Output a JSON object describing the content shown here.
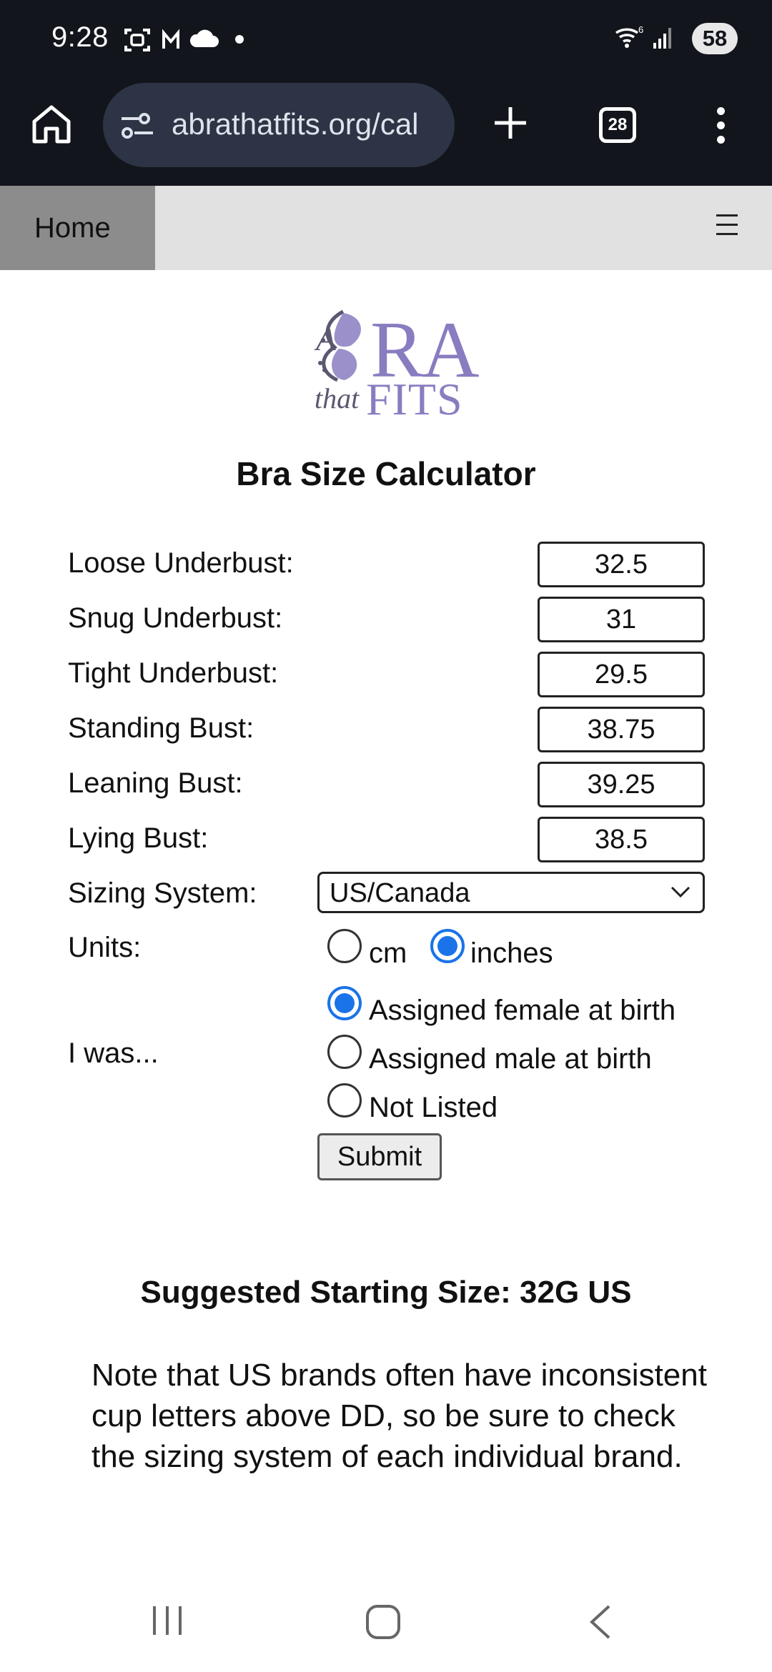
{
  "status_bar": {
    "time": "9:28",
    "battery": "58",
    "icons": [
      "screenshot-icon",
      "gmail-icon",
      "cloud-icon",
      "dot-icon",
      "wifi-icon",
      "signal-icon",
      "battery-icon"
    ]
  },
  "browser": {
    "url": "abrathatfits.org/cal",
    "tab_count": "28",
    "icons": [
      "home-icon",
      "site-settings-icon",
      "new-tab-icon",
      "tab-switcher-icon",
      "overflow-menu-icon"
    ]
  },
  "site_nav": {
    "home_label": "Home",
    "menu_icon": "hamburger-icon"
  },
  "logo": {
    "a": "A",
    "ra": "RA",
    "that": "that",
    "fits": "FITS"
  },
  "calculator": {
    "title": "Bra Size Calculator",
    "fields": [
      {
        "label": "Loose Underbust:",
        "value": "32.5"
      },
      {
        "label": "Snug Underbust:",
        "value": "31"
      },
      {
        "label": "Tight Underbust:",
        "value": "29.5"
      },
      {
        "label": "Standing Bust:",
        "value": "38.75"
      },
      {
        "label": "Leaning Bust:",
        "value": "39.25"
      },
      {
        "label": "Lying Bust:",
        "value": "38.5"
      }
    ],
    "sizing_system": {
      "label": "Sizing System:",
      "selected": "US/Canada"
    },
    "units": {
      "label": "Units:",
      "options": [
        "cm",
        "inches"
      ],
      "selected": "inches"
    },
    "assigned": {
      "label": "I was...",
      "options": [
        "Assigned female at birth",
        "Assigned male at birth",
        "Not Listed"
      ],
      "selected": "Assigned female at birth"
    },
    "submit_label": "Submit"
  },
  "result": {
    "title": "Suggested Starting Size: 32G US",
    "note": "Note that US brands often have inconsistent cup letters above DD, so be sure to check the sizing system of each individual brand."
  },
  "colors": {
    "status_bg": "#13151c",
    "url_bg": "#2c3445",
    "nav_bg": "#e1e1e1",
    "nav_active": "#8c8c8c",
    "accent": "#1a73e8",
    "logo_purple": "#8a7cc0"
  }
}
